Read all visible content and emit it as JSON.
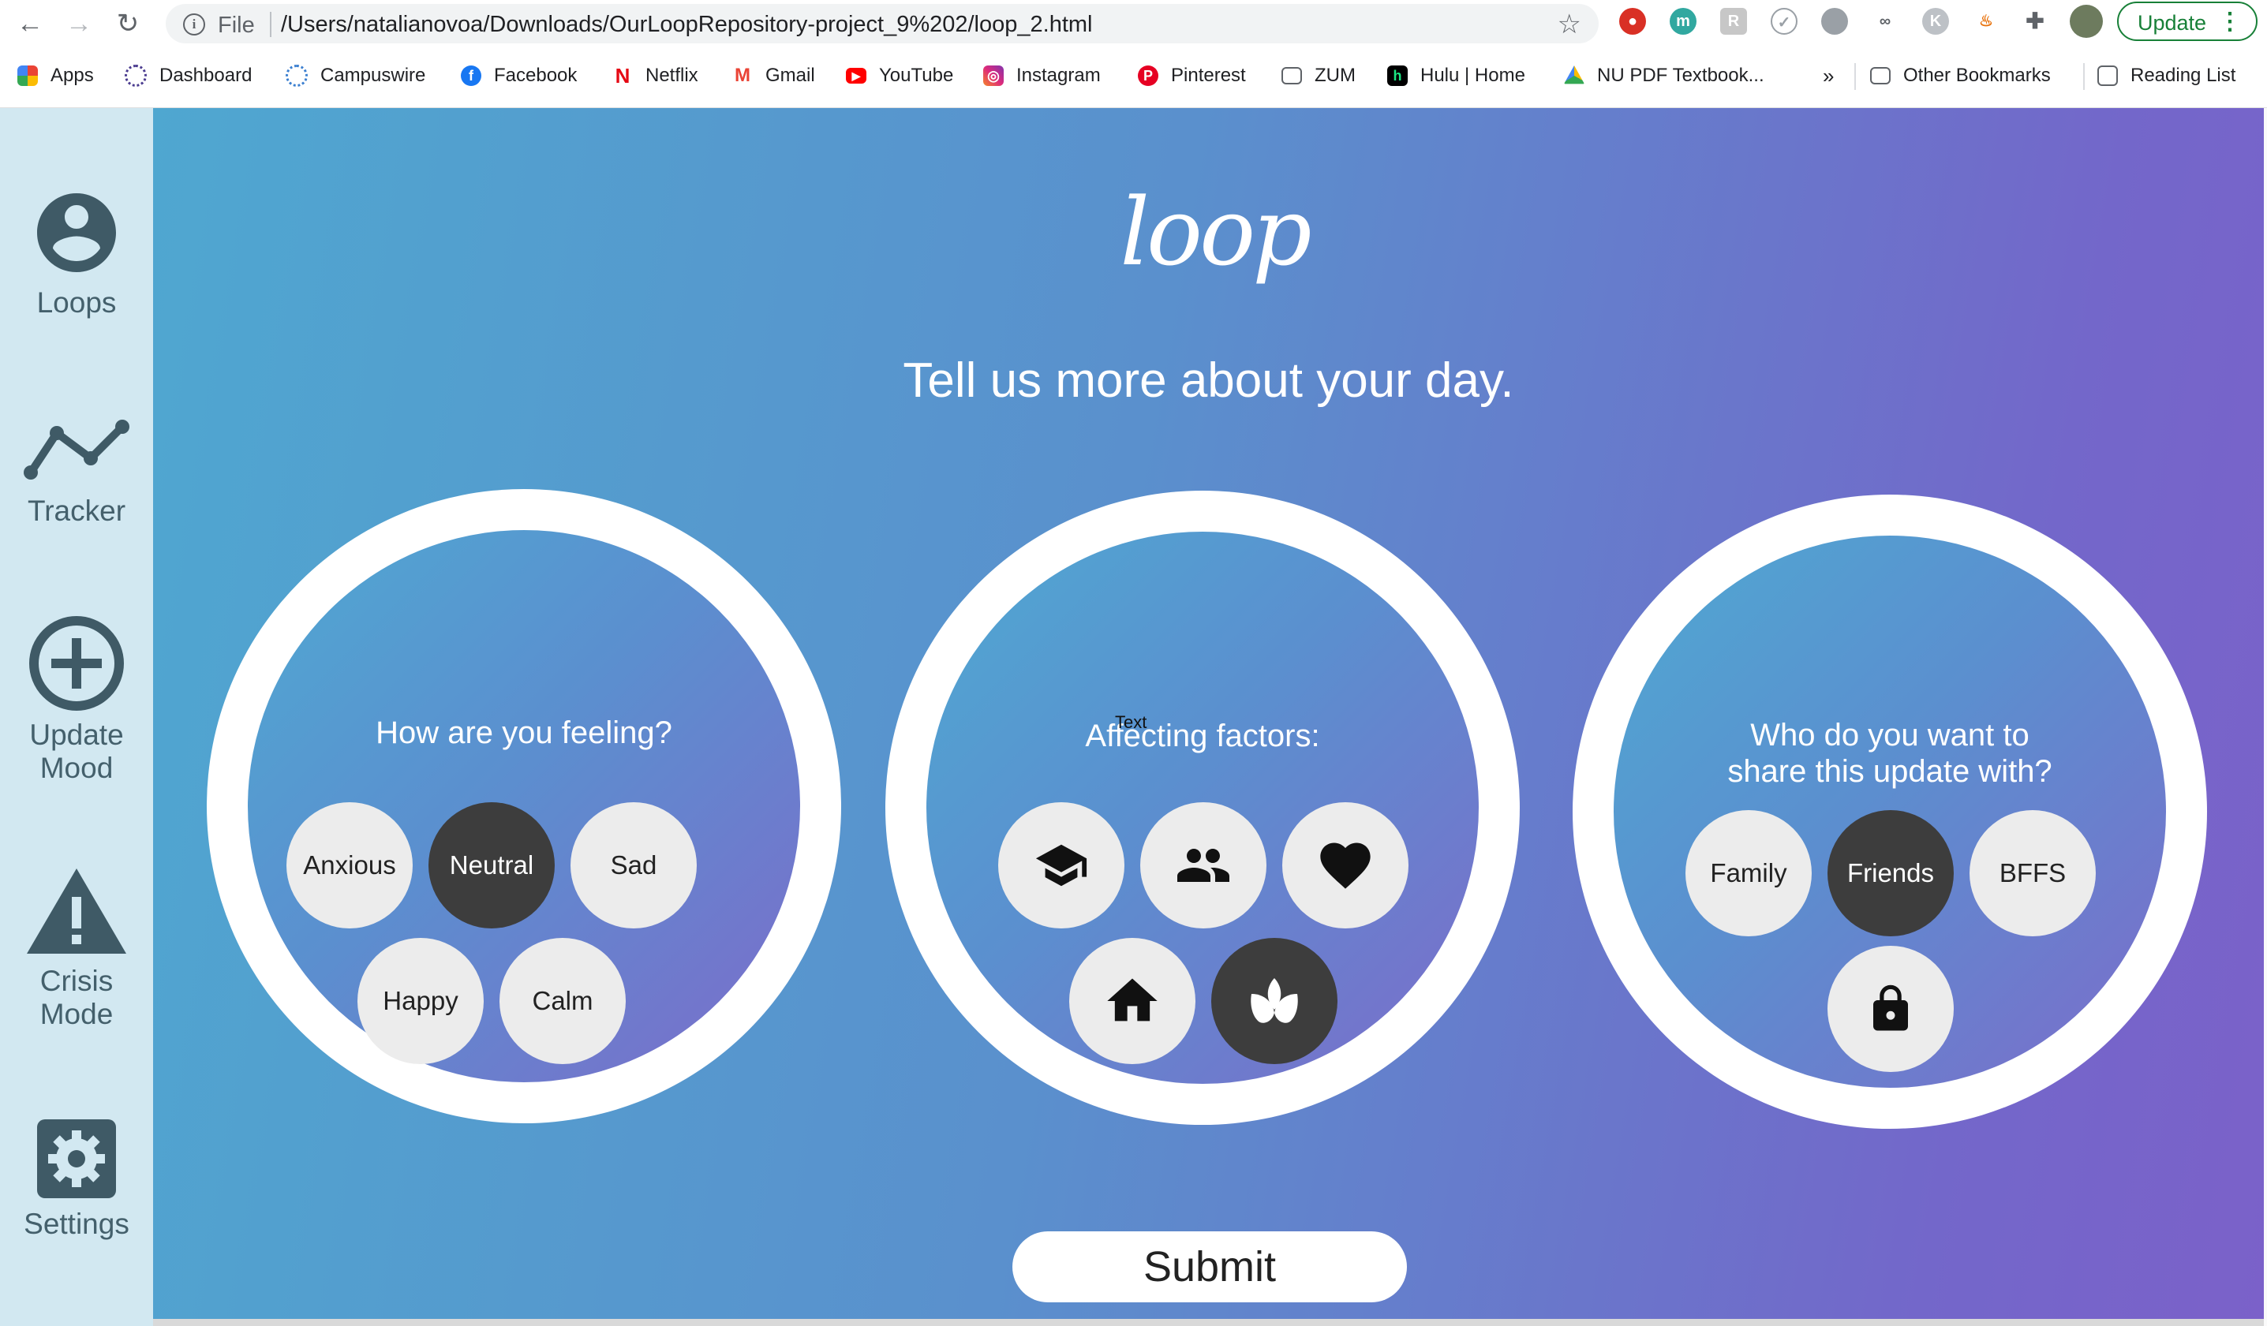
{
  "browser": {
    "file_label": "File",
    "url": "/Users/natalianovoa/Downloads/OurLoopRepository-project_9%202/loop_2.html",
    "update_label": "Update",
    "bookmarks": [
      "Apps",
      "Dashboard",
      "Campuswire",
      "Facebook",
      "Netflix",
      "Gmail",
      "YouTube",
      "Instagram",
      "Pinterest",
      "ZUM",
      "Hulu | Home",
      "NU PDF Textbook..."
    ],
    "overflow": "»",
    "other_bookmarks": "Other Bookmarks",
    "reading_list": "Reading List"
  },
  "sidebar": {
    "items": [
      {
        "label": "Loops",
        "icon": "account-circle-icon"
      },
      {
        "label": "Tracker",
        "icon": "line-chart-icon"
      },
      {
        "label": "Update Mood",
        "icon": "add-circle-icon"
      },
      {
        "label": "Crisis Mode",
        "icon": "warning-icon"
      },
      {
        "label": "Settings",
        "icon": "settings-icon"
      }
    ]
  },
  "main": {
    "logo": "loop",
    "headline": "Tell us more about your day.",
    "feeling": {
      "question": "How are you feeling?",
      "options": [
        "Anxious",
        "Neutral",
        "Sad",
        "Happy",
        "Calm"
      ],
      "selected": "Neutral"
    },
    "factors": {
      "question": "Affecting factors:",
      "overlay_text": "Text",
      "options": [
        "school-icon",
        "people-icon",
        "heart-icon",
        "home-icon",
        "self-care-icon"
      ],
      "selected": "self-care-icon"
    },
    "share": {
      "question_line1": "Who do you want to",
      "question_line2": "share this update with?",
      "options": [
        "Family",
        "Friends",
        "BFFS"
      ],
      "private_icon": "lock-icon",
      "selected": "Friends"
    },
    "submit_label": "Submit"
  },
  "colors": {
    "gradient_start": "#4fa7d0",
    "gradient_end": "#7b61c9",
    "sidebar_bg": "#d2e8f1",
    "chip_default": "#ececec",
    "chip_selected": "#3d3d3d"
  }
}
